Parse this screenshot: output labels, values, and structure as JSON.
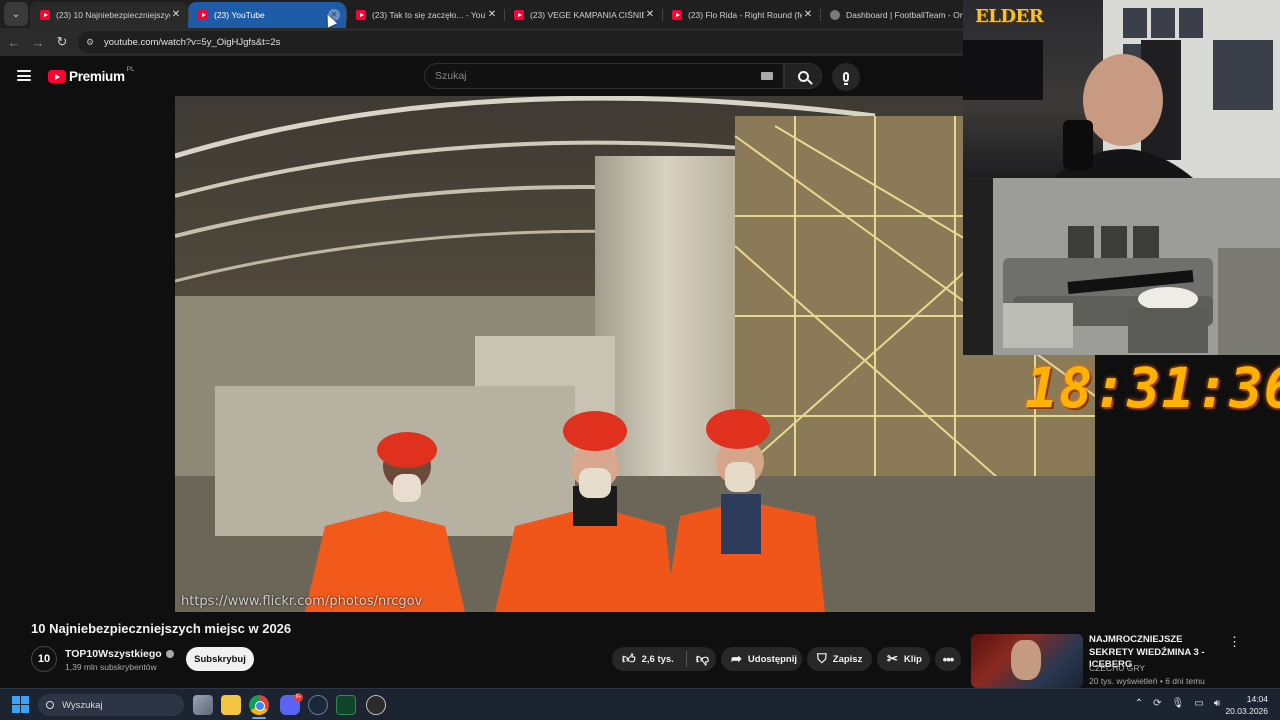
{
  "browser": {
    "tabs": [
      {
        "label": "(23) 10 Najniebezpieczniejszych",
        "favicon": "youtube-icon",
        "state": "open"
      },
      {
        "label": "(23) YouTube",
        "favicon": "youtube-icon",
        "state": "active"
      },
      {
        "label": "(23) Tak to się zaczęło... - YouTu",
        "favicon": "youtube-icon",
        "state": "open"
      },
      {
        "label": "(23) VEGE KAMPANIA CIŚNIENI",
        "favicon": "youtube-icon",
        "state": "open"
      },
      {
        "label": "(23) Flo Rida - Right Round (fea",
        "favicon": "youtube-icon",
        "state": "open"
      },
      {
        "label": "Dashboard | FootballTeam - On",
        "favicon": "globe-icon",
        "state": "open"
      }
    ],
    "url": "youtube.com/watch?v=5y_OigHJgfs&t=2s"
  },
  "youtube": {
    "logo_text": "Premium",
    "region": "PL",
    "search_placeholder": "Szukaj"
  },
  "video": {
    "title": "10 Najniebezpieczniejszych miejsc w 2026",
    "watermark": "https://www.flickr.com/photos/nrcgov"
  },
  "channel": {
    "avatar_text": "10",
    "name": "TOP10Wszystkiego",
    "subscribers": "1,39 mln subskrybentów",
    "subscribe_label": "Subskrybuj"
  },
  "actions": {
    "likes": "2,6 tys.",
    "share": "Udostępnij",
    "save": "Zapisz",
    "clip": "Klip"
  },
  "recommended": [
    {
      "title": "NAJMROCZNIEJSZE SEKRETY WIEDŹMINA 3 - ICEBERG",
      "channel": "CZECHU GRY",
      "meta": "20 tys. wyświetleń • 6 dni temu"
    }
  ],
  "stream_overlay": {
    "logo": "ELDER",
    "clock": "18:31:36"
  },
  "taskbar": {
    "search_placeholder": "Wyszukaj",
    "discord_badge": "9+",
    "time": "14:04",
    "date": "20.03.2026"
  },
  "colors": {
    "youtube_red": "#ff0033",
    "active_tab": "#1e5ca8",
    "clock_orange": "#ffb300"
  }
}
